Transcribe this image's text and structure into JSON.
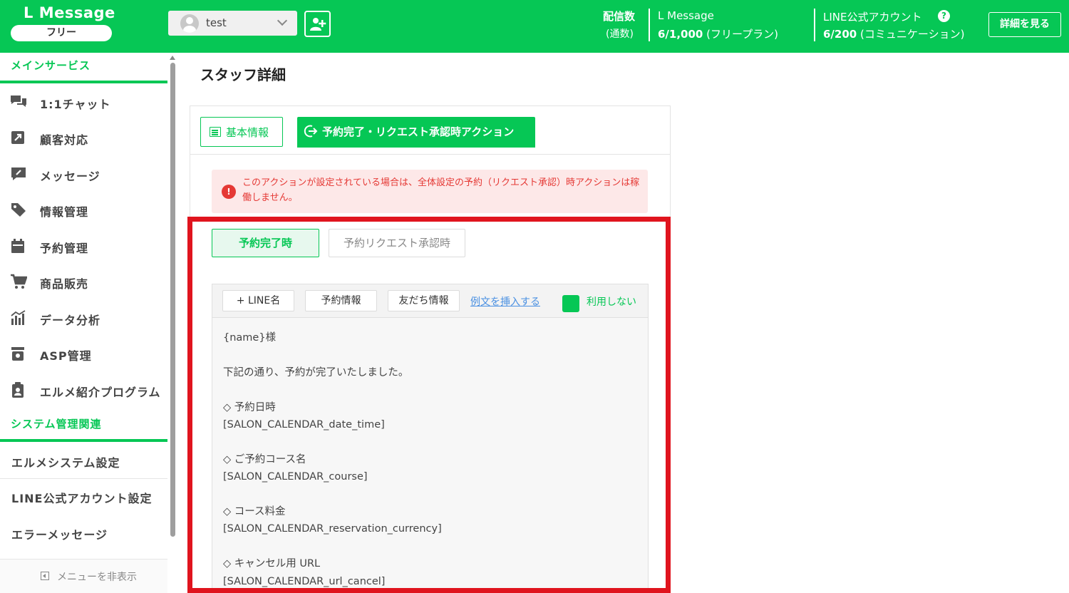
{
  "header": {
    "logo": "L Message",
    "plan_badge": "フリー",
    "account_name": "test",
    "delivery_label": "配信数",
    "delivery_sub": "(通数)",
    "lmessage_name": "L Message",
    "lmessage_count": "6/1,000",
    "lmessage_plan": "(フリープラン)",
    "line_account_name": "LINE公式アカウント",
    "line_account_count": "6/200",
    "line_account_plan": "(コミュニケーション)",
    "details_button": "詳細を見る",
    "help_glyph": "?"
  },
  "sidebar": {
    "main_section": "メインサービス",
    "items": [
      {
        "label": "1:1チャット",
        "icon": "chat-icon"
      },
      {
        "label": "顧客対応",
        "icon": "external-link-icon"
      },
      {
        "label": "メッセージ",
        "icon": "message-edit-icon"
      },
      {
        "label": "情報管理",
        "icon": "tag-icon"
      },
      {
        "label": "予約管理",
        "icon": "calendar-icon"
      },
      {
        "label": "商品販売",
        "icon": "cart-icon"
      },
      {
        "label": "データ分析",
        "icon": "bar-chart-icon"
      },
      {
        "label": "ASP管理",
        "icon": "archive-icon"
      },
      {
        "label": "エルメ紹介プログラム",
        "icon": "clipboard-user-icon"
      }
    ],
    "system_section": "システム管理関連",
    "system_items": [
      "エルメシステム設定",
      "LINE公式アカウント設定",
      "エラーメッセージ"
    ],
    "hide_menu": "メニューを非表示"
  },
  "main": {
    "page_title": "スタッフ詳細",
    "tab_basic": "基本情報",
    "tab_action": "予約完了・リクエスト承認時アクション",
    "alert_icon": "!",
    "alert_text": "このアクションが設定されている場合は、全体設定の予約（リクエスト承認）時アクションは稼働しません。",
    "subtab_complete": "予約完了時",
    "subtab_request": "予約リクエスト承認時",
    "toolbar": {
      "line_name": "+ LINE名",
      "reservation_info": "予約情報",
      "friend_info": "友だち情報",
      "insert_sample": "例文を挿入する",
      "not_use": "利用しない"
    },
    "message_body": "{name}様\n\n下記の通り、予約が完了いたしました。\n\n◇ 予約日時\n[SALON_CALENDAR_date_time]\n\n◇ ご予約コース名\n[SALON_CALENDAR_course]\n\n◇ コース料金\n[SALON_CALENDAR_reservation_currency]\n\n◇ キャンセル用 URL\n[SALON_CALENDAR_url_cancel]"
  },
  "colors": {
    "brand_green": "#06c755",
    "alert_red": "#e53935",
    "highlight_frame": "#e0141e"
  }
}
